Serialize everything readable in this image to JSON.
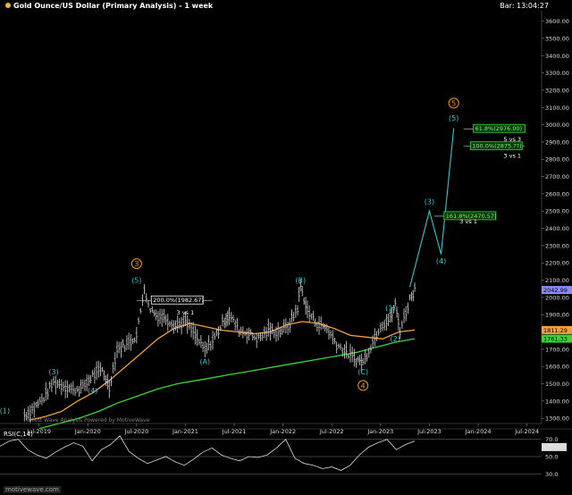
{
  "header": {
    "title": "Gold Ounce/US Dollar (Primary Analysis) - 1 week",
    "bar": "Bar: 13:04:27"
  },
  "watermark": "Elliott Wave Analysis Powered by MotiveWave",
  "footer_site": "motivewave.com",
  "colors": {
    "background": "#000000",
    "price": "#d8d8d8",
    "ma_fast": "#f0a040",
    "ma_slow": "#39d439",
    "wave_cyan": "#2fc8d0",
    "wave_orange": "#f39a18",
    "fib_green": "#2ddc3a",
    "fib_white": "#ffffff"
  },
  "chart_data": [
    {
      "type": "line",
      "y_axis_ticks": [
        "3600.00",
        "3500.00",
        "3400.00",
        "3300.00",
        "3200.00",
        "3100.00",
        "3000.00",
        "2900.00",
        "2800.00",
        "2700.00",
        "2600.00",
        "2500.00",
        "2400.00",
        "2300.00",
        "2200.00",
        "2100.00",
        "2000.00",
        "1900.00",
        "1800.00",
        "1700.00",
        "1600.00",
        "1500.00",
        "1400.00",
        "1300.00"
      ],
      "ylim": [
        1270,
        3660
      ],
      "x_axis_ticks": [
        "Jul-2019",
        "Jan-2020",
        "Jul-2020",
        "Jan-2021",
        "Jul-2021",
        "Jan-2022",
        "Jul-2022",
        "Jan-2023",
        "Jul-2023",
        "Jan-2024",
        "Jul-2024"
      ],
      "series": [
        {
          "x": [
            2019.35,
            2019.45,
            2019.55,
            2019.65,
            2019.75,
            2019.85,
            2019.95,
            2020.05,
            2020.15,
            2020.22,
            2020.3,
            2020.4,
            2020.5,
            2020.58,
            2020.62,
            2020.7,
            2020.8,
            2020.9,
            2021.0,
            2021.1,
            2021.2,
            2021.3,
            2021.4,
            2021.45,
            2021.55,
            2021.65,
            2021.75,
            2021.85,
            2021.95,
            2022.05,
            2022.15,
            2022.18,
            2022.25,
            2022.35,
            2022.45,
            2022.55,
            2022.65,
            2022.75,
            2022.82,
            2022.9,
            2023.0,
            2023.1,
            2023.15,
            2023.2,
            2023.3,
            2023.35
          ],
          "values": [
            1320,
            1360,
            1420,
            1510,
            1490,
            1465,
            1480,
            1550,
            1580,
            1480,
            1700,
            1730,
            1780,
            2065,
            1950,
            1900,
            1880,
            1840,
            1860,
            1780,
            1690,
            1770,
            1870,
            1900,
            1810,
            1790,
            1760,
            1810,
            1800,
            1830,
            1940,
            2070,
            1920,
            1850,
            1820,
            1730,
            1680,
            1640,
            1625,
            1720,
            1840,
            1880,
            1960,
            1810,
            1990,
            2050
          ]
        },
        {
          "name": "",
          "values": [
            1290,
            1310,
            1340,
            1400,
            1450,
            1520,
            1600,
            1680,
            1760,
            1820,
            1850,
            1830,
            1810,
            1800,
            1790,
            1800,
            1840,
            1860,
            1850,
            1820,
            1780,
            1770,
            1760,
            1800,
            1811
          ]
        },
        {
          "name": "",
          "values": [
            1240,
            1270,
            1300,
            1340,
            1390,
            1430,
            1470,
            1500,
            1520,
            1540,
            1560,
            1580,
            1600,
            1620,
            1640,
            1660,
            1680,
            1710,
            1740,
            1761
          ]
        }
      ],
      "price_tags": [
        "2042.99",
        "1811.29",
        "1761.33"
      ],
      "wave_labels": [
        "(1)",
        "(3)",
        "(4)",
        "3",
        "(5)",
        "(A)",
        "(B)",
        "(C)",
        "4",
        "(1)",
        "(2)",
        "(3)",
        "(4)",
        "5",
        "(5)"
      ],
      "projection": {
        "x": [
          2023.3,
          2023.5,
          2023.62,
          2023.75
        ],
        "values": [
          2060,
          2500,
          2250,
          2980
        ]
      },
      "fib_boxes": [
        {
          "label": "200.0%(1982.67)",
          "value": 1982.67
        },
        {
          "label": "161.8%(2470.57)",
          "value": 2470.57
        },
        {
          "label": "61.8%(2976.00)",
          "value": 2976.0
        },
        {
          "label": "100.0%(2875.??)",
          "value": 2875.0
        }
      ],
      "fib_notes": [
        "3 vs 1",
        "3 vs 1",
        "5 vs 3",
        "3 vs 1"
      ]
    },
    {
      "type": "line",
      "title": "RSI(C,14)",
      "y_axis_ticks": [
        "70.0",
        "50.0",
        "30.0"
      ],
      "ylim": [
        20,
        80
      ],
      "values": [
        62,
        68,
        70,
        58,
        52,
        48,
        55,
        61,
        66,
        62,
        45,
        58,
        64,
        74,
        56,
        48,
        42,
        46,
        50,
        44,
        40,
        47,
        55,
        60,
        52,
        48,
        45,
        50,
        49,
        52,
        60,
        70,
        48,
        42,
        40,
        36,
        38,
        34,
        40,
        52,
        61,
        66,
        70,
        58,
        64,
        68
      ]
    }
  ]
}
